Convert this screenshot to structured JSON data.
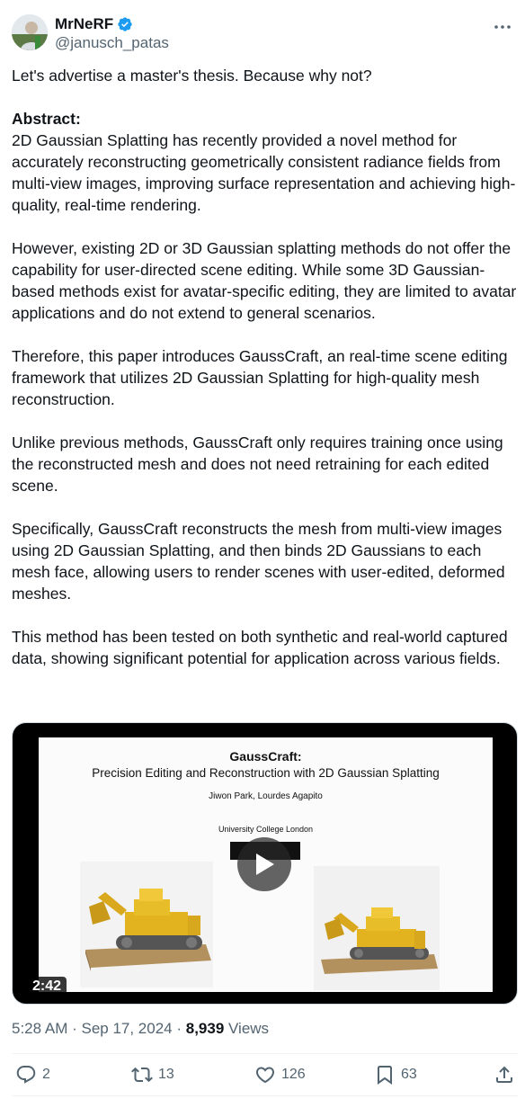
{
  "author": {
    "display_name": "MrNeRF",
    "handle": "@janusch_patas",
    "verified_icon": "verified-badge-icon",
    "verified_color": "#1d9bf0"
  },
  "tweet": {
    "intro": "Let's advertise a master's thesis. Because why not?",
    "abstract_heading": "Abstract:",
    "paragraphs": [
      "2D Gaussian Splatting has recently provided a novel method for accurately reconstructing geometrically consistent radiance fields from multi-view images, improving surface representation and achieving high-quality, real-time rendering.",
      "However, existing 2D or 3D Gaussian splatting methods do not offer the capability for user-directed scene editing. While some 3D Gaussian-based methods exist for avatar-specific editing, they are limited to avatar applications and do not extend to general scenarios.",
      "Therefore, this paper introduces GaussCraft, an real-time scene editing framework that utilizes 2D Gaussian Splatting for high-quality mesh reconstruction.",
      "Unlike previous methods, GaussCraft only requires training once using the reconstructed mesh and does not need retraining for each edited scene.",
      "Specifically, GaussCraft reconstructs the mesh from multi-view images using 2D Gaussian Splatting, and then binds 2D Gaussians to each mesh face, allowing users to render scenes with user-edited, deformed meshes.",
      "This method has been tested on both synthetic and real-world captured data, showing significant potential for application across various fields."
    ]
  },
  "video": {
    "slide_title": "GaussCraft:",
    "slide_subtitle": "Precision Editing and Reconstruction with 2D Gaussian Splatting",
    "slide_authors": "Jiwon Park, Lourdes Agapito",
    "slide_affiliation": "University College London",
    "duration": "2:42",
    "play_icon": "play-icon"
  },
  "meta": {
    "time": "5:28 AM",
    "separator": " · ",
    "date": "Sep 17, 2024",
    "views_count": "8,939",
    "views_label": " Views"
  },
  "actions": {
    "replies": "2",
    "reposts": "13",
    "likes": "126",
    "bookmarks": "63"
  },
  "colors": {
    "text": "#0f1419",
    "secondary": "#536471",
    "divider": "#eff3f4"
  }
}
